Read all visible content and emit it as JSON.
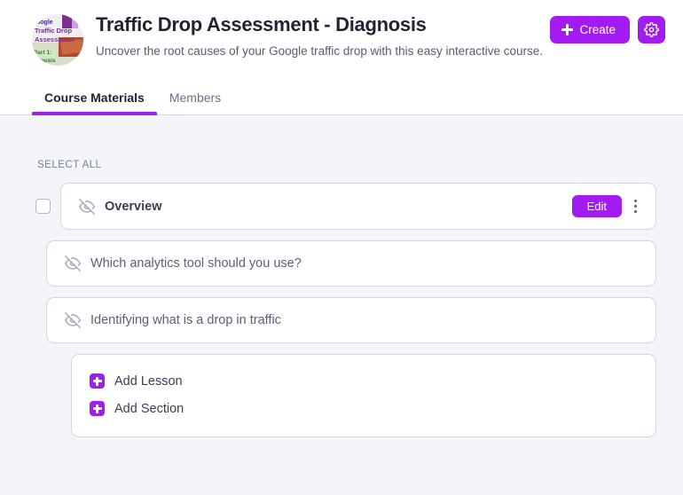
{
  "header": {
    "thumbnail": {
      "icon": "course-thumbnail-image",
      "line1": "Google",
      "line2": "Traffic Drop",
      "line3": "Assessment",
      "line4": "Part 1:",
      "line5": "Diagnosis"
    },
    "title": "Traffic Drop Assessment - Diagnosis",
    "subtitle": "Uncover the root causes of your Google traffic drop with this easy interactive course.",
    "create_label": "Create",
    "create_icon": "plus-icon",
    "settings_icon": "gear-icon"
  },
  "tabs": [
    {
      "label": "Course Materials",
      "active": true
    },
    {
      "label": "Members",
      "active": false
    }
  ],
  "content": {
    "select_all_label": "SELECT ALL",
    "items": [
      {
        "title": "Overview",
        "visibility_icon": "eye-off-icon",
        "checkbox": "unchecked",
        "edit_label": "Edit",
        "menu_icon": "kebab-menu-icon"
      },
      {
        "title": "Which analytics tool should you use?",
        "visibility_icon": "eye-off-icon"
      },
      {
        "title": "Identifying what is a drop in traffic",
        "visibility_icon": "eye-off-icon"
      }
    ],
    "add_actions": [
      {
        "label": "Add Lesson",
        "icon": "plus-square-icon"
      },
      {
        "label": "Add Section",
        "icon": "plus-square-icon"
      }
    ]
  },
  "colors": {
    "accent": "#a21bf0",
    "page_bg": "#f4f5f9",
    "card_bg": "#ffffff",
    "card_border": "#d3d7e2",
    "text_primary": "#1f2430",
    "text_secondary": "#5b6176",
    "text_muted": "#7b8193"
  }
}
